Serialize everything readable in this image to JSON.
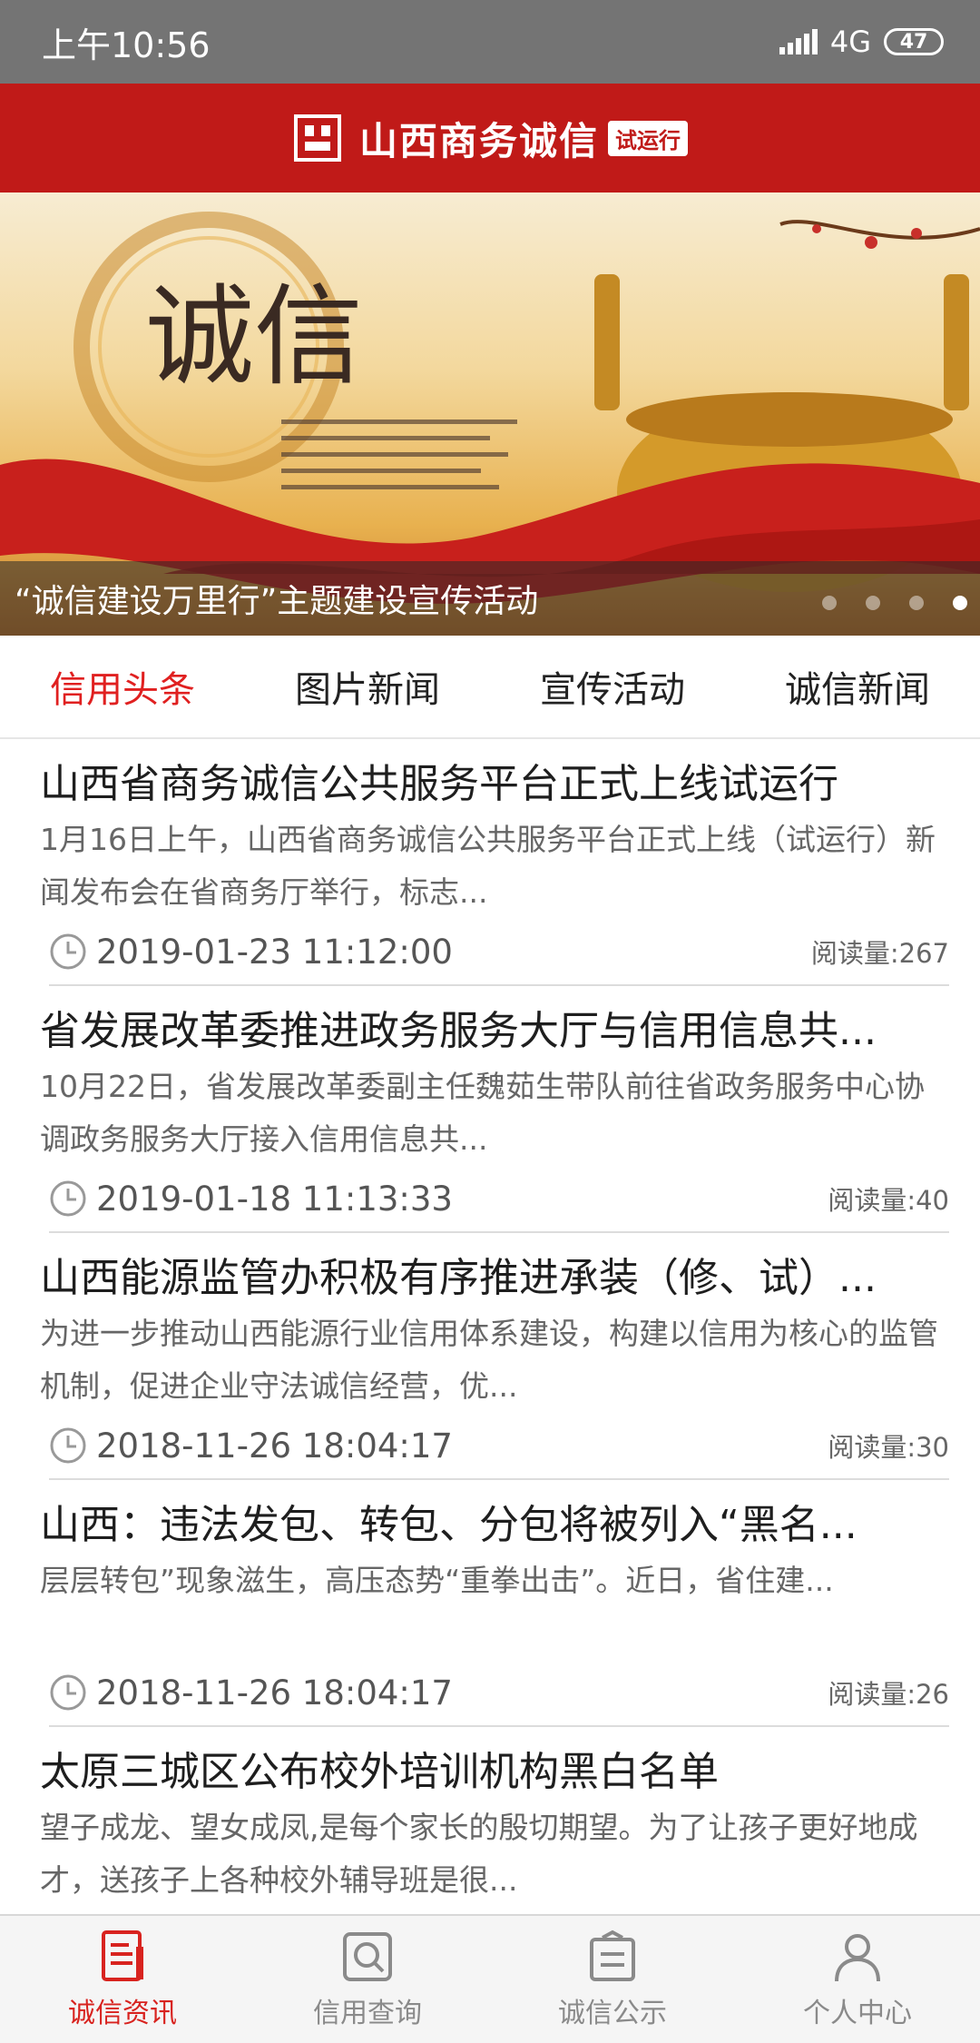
{
  "status": {
    "time": "上午10:56",
    "network": "4G",
    "battery": "47"
  },
  "header": {
    "title": "山西商务诚信",
    "badge": "试运行"
  },
  "banner": {
    "caption": "“诚信建设万里行”主题建设宣传活动",
    "art_text": "诚信",
    "slide_count": 4,
    "active_slide": 4
  },
  "tabs": [
    "信用头条",
    "图片新闻",
    "宣传活动",
    "诚信新闻"
  ],
  "active_tab": 0,
  "reads_label": "阅读量:",
  "news": [
    {
      "title": "山西省商务诚信公共服务平台正式上线试运行",
      "summary": "1月16日上午，山西省商务诚信公共服务平台正式上线（试运行）新闻发布会在省商务厅举行，标志...",
      "date": "2019-01-23 11:12:00",
      "reads": "267"
    },
    {
      "title": "省发展改革委推进政务服务大厅与信用信息共...",
      "summary": "10月22日，省发展改革委副主任魏茹生带队前往省政务服务中心协调政务服务大厅接入信用信息共...",
      "date": "2019-01-18 11:13:33",
      "reads": "40"
    },
    {
      "title": "山西能源监管办积极有序推进承装（修、试）...",
      "summary": "为进一步推动山西能源行业信用体系建设，构建以信用为核心的监管机制，促进企业守法诚信经营，优...",
      "date": "2018-11-26 18:04:17",
      "reads": "30"
    },
    {
      "title": "山西：违法发包、转包、分包将被列入“黑名...",
      "summary": "层层转包”现象滋生，高压态势“重拳出击”。近日，省住建...",
      "date": "2018-11-26 18:04:17",
      "reads": "26"
    },
    {
      "title": "太原三城区公布校外培训机构黑白名单",
      "summary": "望子成龙、望女成凤,是每个家长的殷切期望。为了让孩子更好地成才，送孩子上各种校外辅导班是很...",
      "date": "",
      "reads": ""
    }
  ],
  "bottom_nav": [
    {
      "label": "诚信资讯",
      "icon": "news-doc-icon"
    },
    {
      "label": "信用查询",
      "icon": "search-icon"
    },
    {
      "label": "诚信公示",
      "icon": "publicity-board-icon"
    },
    {
      "label": "个人中心",
      "icon": "person-icon"
    }
  ],
  "active_nav": 0,
  "colors": {
    "brand_red": "#c01a18",
    "active_tab": "#e02020",
    "nav_active": "#d8231f"
  }
}
